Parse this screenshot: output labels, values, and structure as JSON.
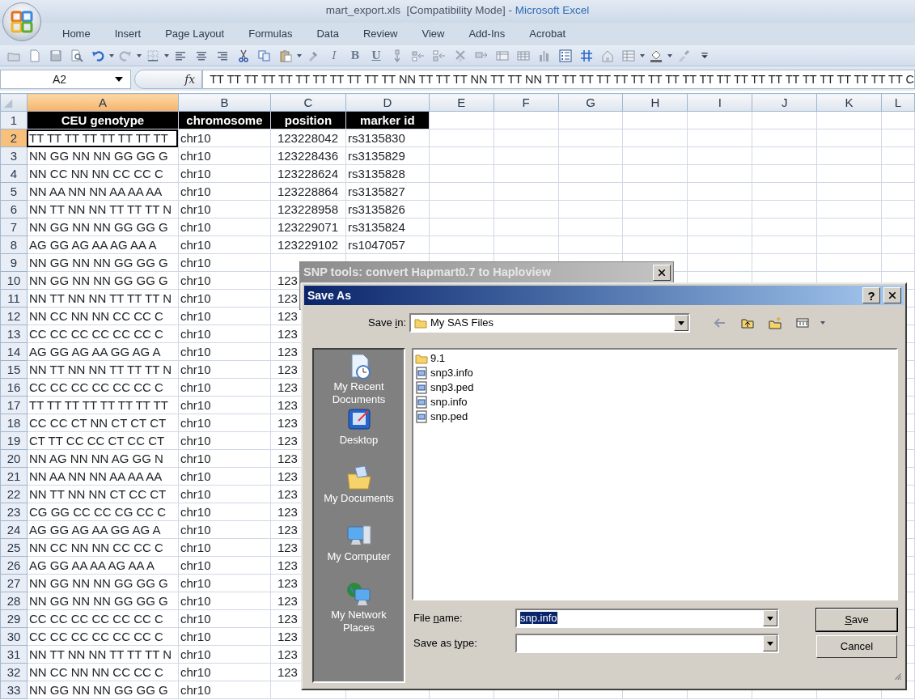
{
  "window": {
    "title": "mart_export.xls  [Compatibility Mode] - ",
    "app_name": "Microsoft Excel"
  },
  "ribbon_tabs": [
    {
      "label": "Home"
    },
    {
      "label": "Insert"
    },
    {
      "label": "Page Layout"
    },
    {
      "label": "Formulas"
    },
    {
      "label": "Data"
    },
    {
      "label": "Review"
    },
    {
      "label": "View"
    },
    {
      "label": "Add-Ins"
    },
    {
      "label": "Acrobat"
    }
  ],
  "toolbar": {
    "style_buttons": [
      "I",
      "B",
      "U"
    ]
  },
  "formula_bar": {
    "name_box": "A2",
    "fx_label": "fx",
    "formula": "TT TT TT TT TT TT TT TT TT TT TT NN TT TT TT NN TT TT NN TT TT TT TT TT TT TT TT TT TT TT TT TT TT TT TT TT TT TT TT TT C"
  },
  "sheet": {
    "columns": [
      {
        "label": "A",
        "selected": true
      },
      {
        "label": "B",
        "selected": false
      },
      {
        "label": "C",
        "selected": false
      },
      {
        "label": "D",
        "selected": false
      },
      {
        "label": "E",
        "selected": false
      },
      {
        "label": "F",
        "selected": false
      },
      {
        "label": "G",
        "selected": false
      },
      {
        "label": "H",
        "selected": false
      },
      {
        "label": "I",
        "selected": false
      },
      {
        "label": "J",
        "selected": false
      },
      {
        "label": "K",
        "selected": false
      },
      {
        "label": "L",
        "selected": false
      }
    ],
    "rows": [
      {
        "number": "1",
        "selected": false,
        "kind": "header",
        "cells": [
          "CEU genotype",
          "chromosome",
          "position",
          "marker id"
        ]
      },
      {
        "number": "2",
        "selected": true,
        "kind": "data",
        "cells": [
          "TT TT TT TT TT TT TT TT",
          "chr10",
          "123228042",
          "rs3135830"
        ]
      },
      {
        "number": "3",
        "selected": false,
        "kind": "data",
        "cells": [
          "NN GG NN NN GG GG G",
          "chr10",
          "123228436",
          "rs3135829"
        ]
      },
      {
        "number": "4",
        "selected": false,
        "kind": "data",
        "cells": [
          "NN CC NN NN CC CC C",
          "chr10",
          "123228624",
          "rs3135828"
        ]
      },
      {
        "number": "5",
        "selected": false,
        "kind": "data",
        "cells": [
          "NN AA NN NN AA AA AA",
          "chr10",
          "123228864",
          "rs3135827"
        ]
      },
      {
        "number": "6",
        "selected": false,
        "kind": "data",
        "cells": [
          "NN TT NN NN TT TT TT N",
          "chr10",
          "123228958",
          "rs3135826"
        ]
      },
      {
        "number": "7",
        "selected": false,
        "kind": "data",
        "cells": [
          "NN GG NN NN GG GG G",
          "chr10",
          "123229071",
          "rs3135824"
        ]
      },
      {
        "number": "8",
        "selected": false,
        "kind": "data",
        "cells": [
          "AG GG AG AA AG AA A",
          "chr10",
          "123229102",
          "rs1047057"
        ]
      },
      {
        "number": "9",
        "selected": false,
        "kind": "data",
        "cells": [
          "NN GG NN NN GG GG G",
          "chr10"
        ]
      },
      {
        "number": "10",
        "selected": false,
        "kind": "data",
        "cells": [
          "NN GG NN NN GG GG G",
          "chr10",
          "123"
        ]
      },
      {
        "number": "11",
        "selected": false,
        "kind": "data",
        "cells": [
          "NN TT NN NN TT TT TT N",
          "chr10",
          "123"
        ]
      },
      {
        "number": "12",
        "selected": false,
        "kind": "data",
        "cells": [
          "NN CC NN NN CC CC C",
          "chr10",
          "123"
        ]
      },
      {
        "number": "13",
        "selected": false,
        "kind": "data",
        "cells": [
          "CC CC CC CC CC CC C",
          "chr10",
          "123"
        ]
      },
      {
        "number": "14",
        "selected": false,
        "kind": "data",
        "cells": [
          "AG GG AG AA GG AG A",
          "chr10",
          "123"
        ]
      },
      {
        "number": "15",
        "selected": false,
        "kind": "data",
        "cells": [
          "NN TT NN NN TT TT TT N",
          "chr10",
          "123"
        ]
      },
      {
        "number": "16",
        "selected": false,
        "kind": "data",
        "cells": [
          "CC CC CC CC CC CC C",
          "chr10",
          "123"
        ]
      },
      {
        "number": "17",
        "selected": false,
        "kind": "data",
        "cells": [
          "TT TT TT TT TT TT TT TT",
          "chr10",
          "123"
        ]
      },
      {
        "number": "18",
        "selected": false,
        "kind": "data",
        "cells": [
          "CC CC CT NN CT CT CT",
          "chr10",
          "123"
        ]
      },
      {
        "number": "19",
        "selected": false,
        "kind": "data",
        "cells": [
          "CT TT CC CC CT CC CT",
          "chr10",
          "123"
        ]
      },
      {
        "number": "20",
        "selected": false,
        "kind": "data",
        "cells": [
          "NN AG NN NN AG GG N",
          "chr10",
          "123"
        ]
      },
      {
        "number": "21",
        "selected": false,
        "kind": "data",
        "cells": [
          "NN AA NN NN AA AA AA",
          "chr10",
          "123"
        ]
      },
      {
        "number": "22",
        "selected": false,
        "kind": "data",
        "cells": [
          "NN TT NN NN CT CC CT",
          "chr10",
          "123"
        ]
      },
      {
        "number": "23",
        "selected": false,
        "kind": "data",
        "cells": [
          "CG GG CC CC CG CC C",
          "chr10",
          "123"
        ]
      },
      {
        "number": "24",
        "selected": false,
        "kind": "data",
        "cells": [
          "AG GG AG AA GG AG A",
          "chr10",
          "123"
        ]
      },
      {
        "number": "25",
        "selected": false,
        "kind": "data",
        "cells": [
          "NN CC NN NN CC CC C",
          "chr10",
          "123"
        ]
      },
      {
        "number": "26",
        "selected": false,
        "kind": "data",
        "cells": [
          "AG GG AA AA AG AA A",
          "chr10",
          "123"
        ]
      },
      {
        "number": "27",
        "selected": false,
        "kind": "data",
        "cells": [
          "NN GG NN NN GG GG G",
          "chr10",
          "123"
        ]
      },
      {
        "number": "28",
        "selected": false,
        "kind": "data",
        "cells": [
          "NN GG NN NN GG GG G",
          "chr10",
          "123"
        ]
      },
      {
        "number": "29",
        "selected": false,
        "kind": "data",
        "cells": [
          "CC CC CC CC CC CC C",
          "chr10",
          "123"
        ]
      },
      {
        "number": "30",
        "selected": false,
        "kind": "data",
        "cells": [
          "CC CC CC CC CC CC C",
          "chr10",
          "123"
        ]
      },
      {
        "number": "31",
        "selected": false,
        "kind": "data",
        "cells": [
          "NN TT NN NN TT TT TT N",
          "chr10",
          "123"
        ]
      },
      {
        "number": "32",
        "selected": false,
        "kind": "data",
        "cells": [
          "NN CC NN NN CC CC C",
          "chr10",
          "123"
        ]
      },
      {
        "number": "33",
        "selected": false,
        "kind": "data",
        "cells": [
          "NN GG NN NN GG GG G",
          "chr10"
        ]
      }
    ]
  },
  "snp_dialog": {
    "title": "SNP tools: convert Hapmart0.7 to Haploview"
  },
  "save_dialog": {
    "title": "Save As",
    "help": "?",
    "save_in": {
      "label": [
        {
          "text": "Save ",
          "underlined": false
        },
        {
          "text": "i",
          "underlined": true
        },
        {
          "text": "n:",
          "underlined": false
        }
      ],
      "value": "My SAS Files"
    },
    "places": [
      {
        "label": "My Recent Documents",
        "kind": "recent"
      },
      {
        "label": "Desktop",
        "kind": "desktop"
      },
      {
        "label": "My Documents",
        "kind": "documents"
      },
      {
        "label": "My Computer",
        "kind": "computer"
      },
      {
        "label": "My Network Places",
        "kind": "network"
      }
    ],
    "files": [
      {
        "name": "9.1",
        "kind": "folder"
      },
      {
        "name": "snp3.info",
        "kind": "file"
      },
      {
        "name": "snp3.ped",
        "kind": "file"
      },
      {
        "name": "snp.info",
        "kind": "file"
      },
      {
        "name": "snp.ped",
        "kind": "file"
      }
    ],
    "file_name": {
      "label": [
        {
          "text": "File ",
          "underlined": false
        },
        {
          "text": "n",
          "underlined": true
        },
        {
          "text": "ame:",
          "underlined": false
        }
      ],
      "value": "snp.info",
      "text_selected": true
    },
    "save_as_type": {
      "label": [
        {
          "text": "Save as ",
          "underlined": false
        },
        {
          "text": "t",
          "underlined": true
        },
        {
          "text": "ype:",
          "underlined": false
        }
      ]
    },
    "buttons": [
      {
        "label": [
          {
            "text": "S",
            "underlined": true
          },
          {
            "text": "ave",
            "underlined": false
          }
        ],
        "default": true
      },
      {
        "label": [
          {
            "text": "Cancel",
            "underlined": false
          }
        ],
        "default": false
      }
    ]
  }
}
